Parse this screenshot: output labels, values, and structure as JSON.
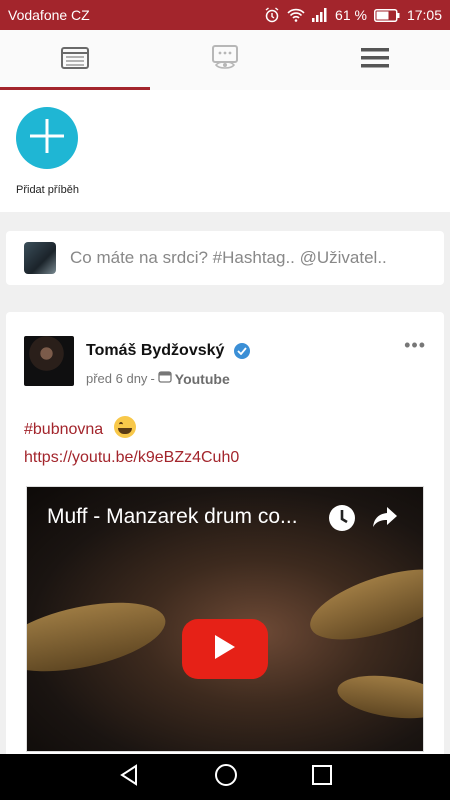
{
  "status_bar": {
    "carrier": "Vodafone CZ",
    "battery": "61 %",
    "time": "17:05",
    "icons": [
      "alarm-icon",
      "wifi-icon",
      "signal-icon",
      "battery-icon"
    ]
  },
  "tabs": [
    {
      "name": "feed-tab",
      "icon": "browser-window-icon",
      "active": true
    },
    {
      "name": "chat-tab",
      "icon": "chat-eye-icon",
      "active": false
    },
    {
      "name": "menu-tab",
      "icon": "hamburger-menu-icon",
      "active": false
    }
  ],
  "stories": {
    "add_label": "Přidat příběh"
  },
  "composer": {
    "placeholder": "Co máte na srdci? #Hashtag.. @Uživatel.."
  },
  "post": {
    "author": "Tomáš Bydžovský",
    "time": "před 6 dny",
    "separator": "-",
    "source": "Youtube",
    "hashtag": "#bubnovna",
    "link": "https://youtu.be/k9eBZz4Cuh0",
    "video": {
      "title": "Muff - Manzarek drum co..."
    }
  },
  "colors": {
    "accent": "#a3252c",
    "story_button": "#1fb6d4",
    "youtube_red": "#e62117",
    "verified": "#3b8fd6"
  }
}
